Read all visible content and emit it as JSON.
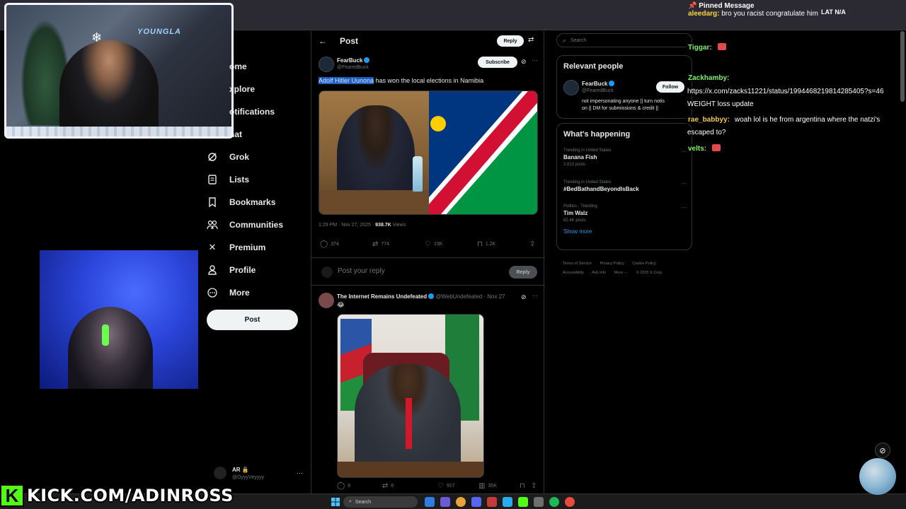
{
  "chat": {
    "pinned_title": "Pinned Message",
    "pinned_user": "aleedarg:",
    "pinned_text": "bro you racist congratulate him",
    "status_right": "LAT  N/A",
    "lines": [
      {
        "user": "Tiggar:",
        "msg": "",
        "color": "#7ef06a",
        "emote": true
      },
      {
        "user": "Zackhamby:",
        "msg": "",
        "color": "#7ef06a",
        "emote": false
      },
      {
        "user": "",
        "msg": "https://x.com/zacks11221/status/1994468219814285405?s=46",
        "color": "#fff",
        "emote": false
      },
      {
        "user": "",
        "msg": "WEIGHT loss update",
        "color": "#fff",
        "emote": false
      },
      {
        "user": "rae_babbyy:",
        "msg": "woah lol is he from argentina where the natzi's",
        "color": "#f7c948",
        "emote": false
      },
      {
        "user": "",
        "msg": "escaped to?",
        "color": "#fff",
        "emote": false
      },
      {
        "user": "velts:",
        "msg": "",
        "color": "#7ef06a",
        "emote": true
      }
    ]
  },
  "webcam": {
    "logo": "YOUNGLA"
  },
  "nav": {
    "items": [
      {
        "label": "Home",
        "icon": "home-icon",
        "glyph": "⌂"
      },
      {
        "label": "Explore",
        "icon": "search-icon",
        "glyph": "⌕"
      },
      {
        "label": "Notifications",
        "icon": "bell-icon",
        "glyph": "🔔"
      },
      {
        "label": "Chat",
        "icon": "mail-icon",
        "glyph": "✉"
      },
      {
        "label": "Grok",
        "icon": "grok-icon",
        "glyph": "⟋"
      },
      {
        "label": "Lists",
        "icon": "list-icon",
        "glyph": "☰"
      },
      {
        "label": "Bookmarks",
        "icon": "bookmark-icon",
        "glyph": "🔖"
      },
      {
        "label": "Communities",
        "icon": "people-icon",
        "glyph": "👥"
      },
      {
        "label": "Premium",
        "icon": "x-logo-icon",
        "glyph": "✕"
      },
      {
        "label": "Profile",
        "icon": "person-icon",
        "glyph": "👤"
      },
      {
        "label": "More",
        "icon": "more-circle-icon",
        "glyph": "⊙"
      }
    ],
    "visible_labels": [
      "ome",
      "xplore",
      "otifications",
      "hat"
    ],
    "post_button": "Post"
  },
  "account": {
    "name": "AR 🔒",
    "handle": "@OyyyVeyyyy",
    "more": "···"
  },
  "header": {
    "back": "←",
    "title": "Post",
    "reply": "Reply",
    "settings_glyph": "⇄"
  },
  "tweet": {
    "author": "FearBuck",
    "handle": "@FearedBuck",
    "subscribe": "Subscribe",
    "text_highlight": "Adolf Hitler Uunona",
    "text_rest": " has won the local elections in Namibia",
    "time": "1:29 PM · Nov 27, 2025 · ",
    "views_count": "938.7K",
    "views_label": " Views",
    "replies": "374",
    "reposts": "774",
    "likes": "15K",
    "bookmarks": "1.2K"
  },
  "reply_box": {
    "placeholder": "Post your reply",
    "button": "Reply"
  },
  "tweet2": {
    "author": "The Internet Remains Undefeated",
    "handle": "@WebUndefeated · Nov 27",
    "emoji": "😂",
    "replies": "6",
    "reposts": "6",
    "likes": "917",
    "views": "35K"
  },
  "sidebar": {
    "search_placeholder": "Search",
    "relevant_title": "Relevant people",
    "rel_name": "FearBuck",
    "rel_handle": "@FearedBuck",
    "follow": "Follow",
    "bio1": "not impersonating anyone || turn notis",
    "bio2": "on || DM for submissions & credit ||",
    "happening_title": "What's happening",
    "trends": [
      {
        "context": "Trending in United States",
        "topic": "Banana Fish",
        "count": "2,813 posts"
      },
      {
        "context": "Trending in United States",
        "topic": "#BedBathandBeyondIsBack",
        "count": ""
      },
      {
        "context": "Politics · Trending",
        "topic": "Tim Walz",
        "count": "82.4K posts"
      }
    ],
    "show_more": "Show more",
    "footer1": [
      "Terms of Service",
      "Privacy Policy",
      "Cookie Policy"
    ],
    "footer2": [
      "Accessibility",
      "Ads info",
      "More ···",
      "© 2025 X Corp."
    ]
  },
  "taskbar": {
    "search": "Search"
  },
  "overlay": {
    "kick_k": "K",
    "kick_url": "KICK.COM/ADINROSS"
  },
  "colors": {
    "accent": "#1d9bf0",
    "kick_green": "#53fc18",
    "highlight": "#1f5fbf"
  }
}
